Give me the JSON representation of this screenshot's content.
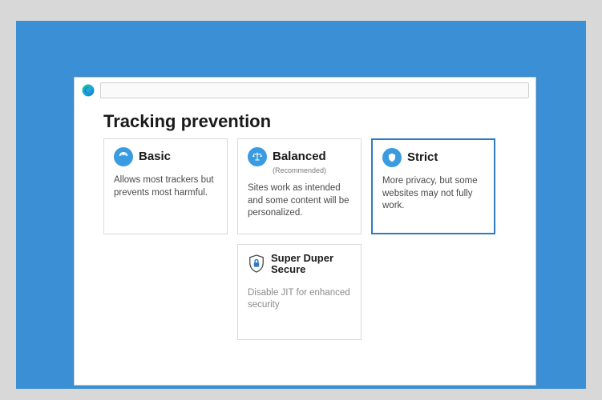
{
  "page": {
    "title": "Tracking prevention"
  },
  "cards": [
    {
      "icon": "face-icon",
      "title": "Basic",
      "subtitle": "",
      "desc": "Allows most trackers but prevents most harmful.",
      "selected": false
    },
    {
      "icon": "scales-icon",
      "title": "Balanced",
      "subtitle": "(Recommended)",
      "desc": "Sites work as intended and some content will be personalized.",
      "selected": false
    },
    {
      "icon": "shield-icon",
      "title": "Strict",
      "subtitle": "",
      "desc": "More privacy, but some websites may not fully work.",
      "selected": true
    },
    {
      "icon": "lock-shield-icon",
      "title": "Super Duper Secure",
      "subtitle": "",
      "desc": "Disable JIT for enhanced security",
      "selected": false
    }
  ]
}
